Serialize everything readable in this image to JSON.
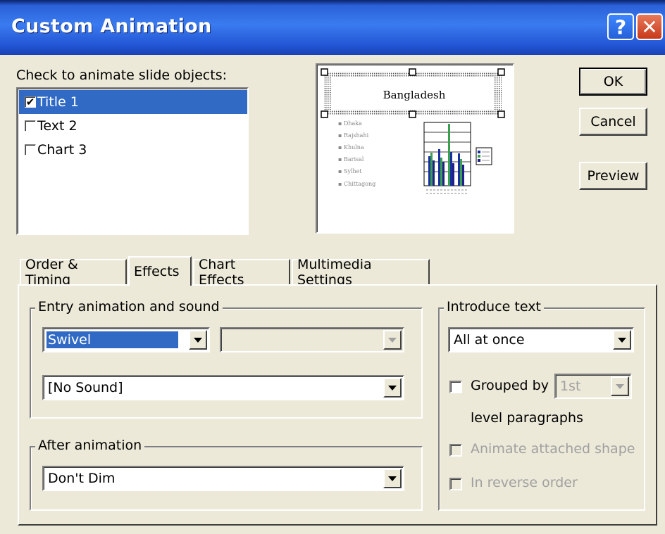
{
  "window": {
    "title": "Custom Animation"
  },
  "titlebar": {
    "help_label": "?",
    "close_label": "✕"
  },
  "objects": {
    "label": "Check to animate slide objects:",
    "items": [
      {
        "label": "Title 1",
        "checked": true,
        "selected": true
      },
      {
        "label": "Text 2",
        "checked": false,
        "selected": false
      },
      {
        "label": "Chart 3",
        "checked": false,
        "selected": false
      }
    ]
  },
  "preview": {
    "slide_title": "Bangladesh",
    "bullets": [
      "Dhaka",
      "Rajshahi",
      "Khulna",
      "Barisal",
      "Sylhet",
      "Chittagong"
    ]
  },
  "buttons": {
    "ok": "OK",
    "cancel": "Cancel",
    "preview": "Preview"
  },
  "tabs": [
    "Order & Timing",
    "Effects",
    "Chart Effects",
    "Multimedia Settings"
  ],
  "active_tab": "Effects",
  "entry": {
    "group_label": "Entry animation and sound",
    "effect_value": "Swivel",
    "direction_value": "",
    "sound_value": "[No Sound]"
  },
  "after": {
    "group_label": "After animation",
    "value": "Don't Dim"
  },
  "introduce": {
    "group_label": "Introduce text",
    "value": "All at once",
    "grouped_by_label": "Grouped by",
    "grouped_by_value": "1st",
    "level_paragraphs_label": "level paragraphs",
    "animate_shape_label": "Animate attached shape",
    "reverse_label": "In reverse order"
  },
  "colors": {
    "title_bar": "#2b60d8",
    "selection": "#316ac5",
    "close_button": "#c8391a"
  }
}
